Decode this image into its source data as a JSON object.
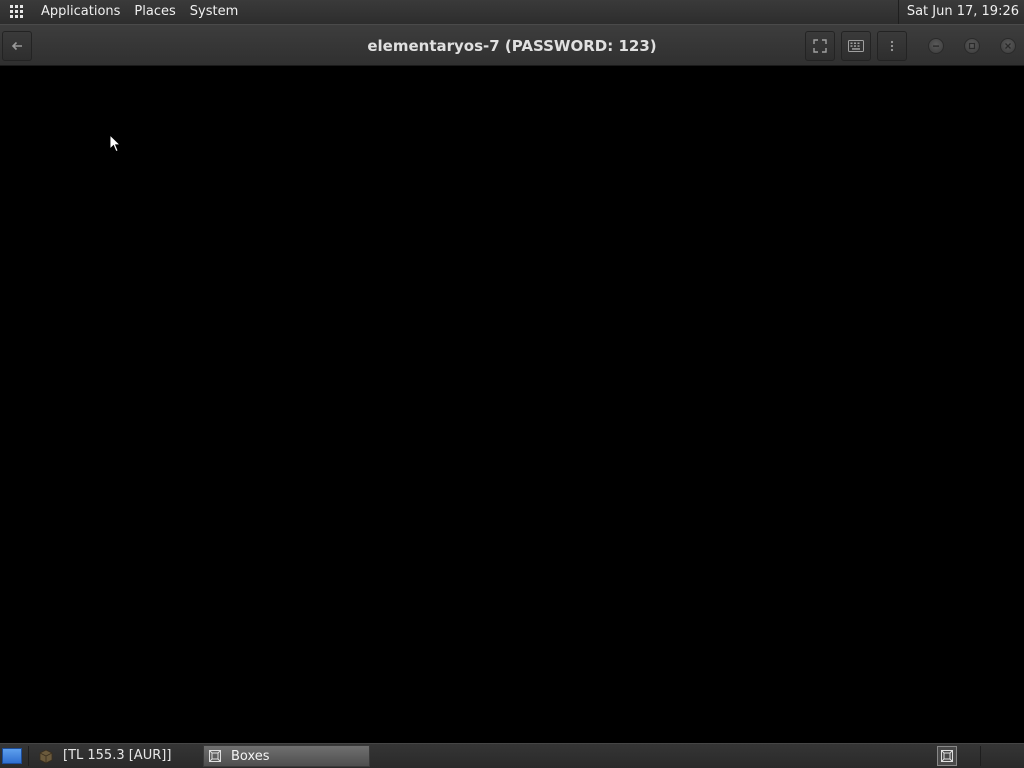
{
  "top_panel": {
    "menus": [
      "Applications",
      "Places",
      "System"
    ],
    "clock": "Sat Jun 17, 19:26"
  },
  "header": {
    "title": "elementaryos-7 (PASSWORD: 123)"
  },
  "bottom_panel": {
    "currency_indicator": "[TL 155.3 [AUR]]",
    "tasks": [
      {
        "label": "Boxes",
        "active": true,
        "icon": "boxes-icon"
      }
    ]
  },
  "icons": {
    "menu": "apps-grid-icon",
    "back": "back-arrow-icon",
    "fullscreen": "fullscreen-icon",
    "keyboard": "keyboard-icon",
    "more": "more-vertical-icon",
    "minimize": "minimize-icon",
    "maximize": "maximize-icon",
    "close": "close-icon",
    "desktop": "show-desktop-icon",
    "package": "package-icon"
  },
  "colors": {
    "panel_bg": "#2d2d2d",
    "display_bg": "#000000",
    "desktop_icon": "#3f82e0"
  }
}
